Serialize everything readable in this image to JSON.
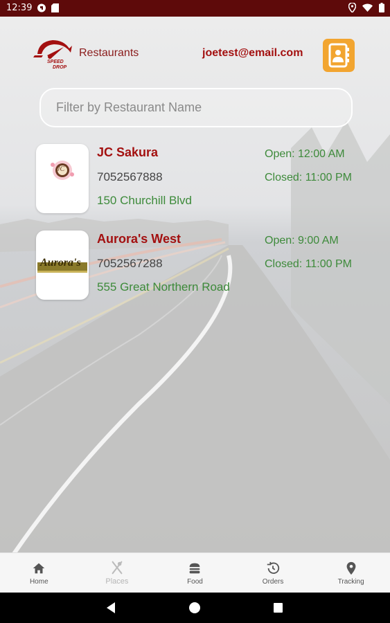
{
  "status_bar": {
    "time": "12:39",
    "icons": [
      "notification-icon",
      "sd-card-icon",
      "location-icon",
      "wifi-icon",
      "battery-icon"
    ]
  },
  "header": {
    "title": "Restaurants",
    "email": "joetest@email.com",
    "logo_text": [
      "SPEED",
      "DROP"
    ],
    "contact_icon": "contact-book-icon"
  },
  "search": {
    "placeholder": "Filter by Restaurant Name",
    "value": ""
  },
  "restaurants": [
    {
      "name": "JC Sakura",
      "phone": "7052567888",
      "address": "150 Churchill Blvd",
      "open": "Open: 12:00 AM",
      "closed": "Closed: 11:00 PM",
      "logo_text": "JC"
    },
    {
      "name": "Aurora's West",
      "phone": "7052567288",
      "address": "555 Great Northern Road",
      "open": "Open: 9:00 AM",
      "closed": "Closed: 11:00 PM",
      "logo_text": "Aurora's"
    }
  ],
  "bottom_nav": {
    "items": [
      {
        "label": "Home",
        "icon": "home-icon"
      },
      {
        "label": "Places",
        "icon": "fork-knife-icon"
      },
      {
        "label": "Food",
        "icon": "burger-icon"
      },
      {
        "label": "Orders",
        "icon": "history-icon"
      },
      {
        "label": "Tracking",
        "icon": "location-pin-icon"
      }
    ]
  },
  "colors": {
    "status_bar": "#5e0a0a",
    "brand_red": "#a31010",
    "accent_orange": "#f2a530",
    "green_text": "#3d8a3a"
  }
}
